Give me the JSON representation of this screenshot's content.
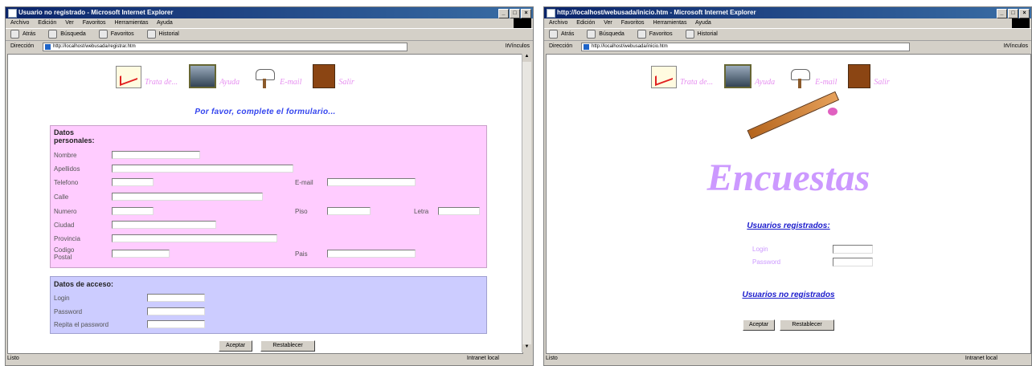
{
  "left_window": {
    "title": "Usuario no registrado - Microsoft Internet Explorer",
    "menu": [
      "Archivo",
      "Edición",
      "Ver",
      "Favoritos",
      "Herramientas",
      "Ayuda"
    ],
    "toolbar": [
      "Atrás",
      "Búsqueda",
      "Favoritos",
      "Historial"
    ],
    "address_label": "Dirección",
    "address": "http://localhost/webusada/registrar.htm",
    "go_label": "Ir",
    "links_label": "Vínculos",
    "nav": [
      "Trata de...",
      "Ayuda",
      "E-mail",
      "Salir"
    ],
    "prompt": "Por favor, complete el formulario...",
    "personal": {
      "title": "Datos personales:",
      "labels": [
        "Nombre",
        "Apellidos",
        "Telefono",
        "E-mail",
        "Calle",
        "Numero",
        "Piso",
        "Letra",
        "Ciudad",
        "Provincia",
        "Codigo Postal",
        "Pais"
      ]
    },
    "access": {
      "title": "Datos de acceso:",
      "labels": [
        "Login",
        "Password",
        "Repita el password"
      ]
    },
    "buttons": {
      "accept": "Aceptar",
      "reset": "Restablecer"
    },
    "status": "Listo",
    "zone": "Intranet local"
  },
  "right_window": {
    "title": "http://localhost/webusada/inicio.htm - Microsoft Internet Explorer",
    "menu": [
      "Archivo",
      "Edición",
      "Ver",
      "Favoritos",
      "Herramientas",
      "Ayuda"
    ],
    "toolbar": [
      "Atrás",
      "Búsqueda",
      "Favoritos",
      "Historial"
    ],
    "address_label": "Dirección",
    "address": "http://localhost/webusada/inicio.htm",
    "go_label": "Ir",
    "links_label": "Vínculos",
    "nav": [
      "Trata de...",
      "Ayuda",
      "E-mail",
      "Salir"
    ],
    "big_title": "Encuestas",
    "registered_heading": "Usuarios registrados:",
    "login_label": "Login",
    "password_label": "Password",
    "unregistered_link": "Usuarios no registrados",
    "buttons": {
      "accept": "Aceptar",
      "reset": "Restablecer"
    },
    "status": "Listo",
    "zone": "Intranet local"
  },
  "colors": {
    "personal_panel": "#ffccff",
    "access_panel": "#ccccff",
    "title_pink": "#cc99ff",
    "link_blue": "#1a1acc",
    "nav_label": "#e690f0"
  }
}
